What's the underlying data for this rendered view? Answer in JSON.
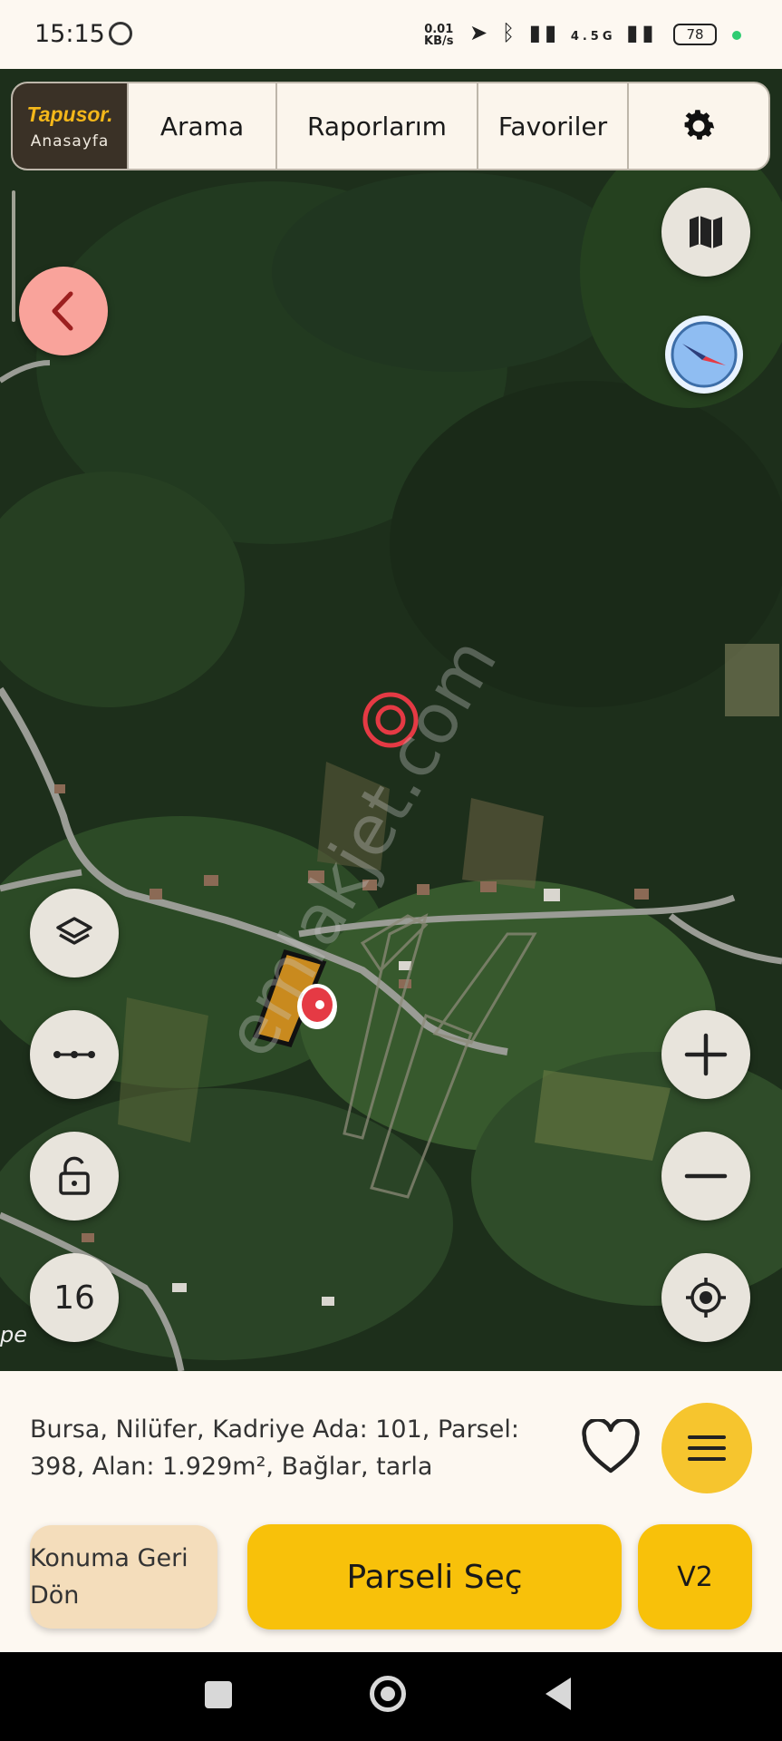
{
  "status_bar": {
    "time": "15:15",
    "net_speed": "0.01",
    "net_unit": "KB/s",
    "signal_label": "4.5G",
    "battery": "78"
  },
  "nav": {
    "brand": "Tapusor.",
    "brand_sub": "Anasayfa",
    "items": [
      "Arama",
      "Raporlarım",
      "Favoriler"
    ],
    "settings_icon": "gear-icon"
  },
  "map": {
    "watermark": "emlakjet.com",
    "zoom_level": "16",
    "map_label": "pe"
  },
  "parcel": {
    "info_line1": "Bursa, Nilüfer, Kadriye Ada: 101, Parsel:",
    "info_line2": "398, Alan: 1.929m², Bağlar, tarla"
  },
  "actions": {
    "konum_line1": "Konuma Geri",
    "konum_line2": "Dön",
    "select_parcel": "Parseli Seç",
    "version": "V2"
  },
  "colors": {
    "accent": "#f8c10a",
    "brand_bg": "#3a3126",
    "back_button": "#f9a39b",
    "parcel_fill": "#c98a1e"
  }
}
